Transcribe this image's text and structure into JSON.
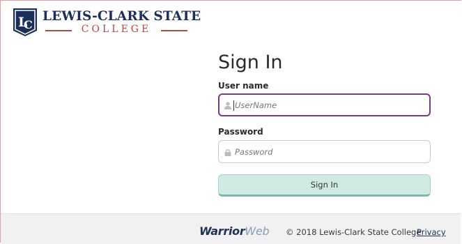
{
  "logo": {
    "name": "LEWIS-CLARK STATE",
    "college": "COLLEGE",
    "colors": {
      "navy": "#1c2f5a",
      "red": "#b8473e"
    }
  },
  "form": {
    "title": "Sign In",
    "username_label": "User name",
    "username_placeholder": "UserName",
    "password_label": "Password",
    "password_placeholder": "Password",
    "submit_label": "Sign In",
    "focus_color": "#7b3a88",
    "button_color": "#cfe9e3"
  },
  "footer": {
    "brand_part1": "Warrior",
    "brand_part2": "Web",
    "copyright": "© 2018 Lewis-Clark State College",
    "privacy_link": "Privacy"
  },
  "icons": {
    "username": "user-icon",
    "password": "lock-icon"
  }
}
